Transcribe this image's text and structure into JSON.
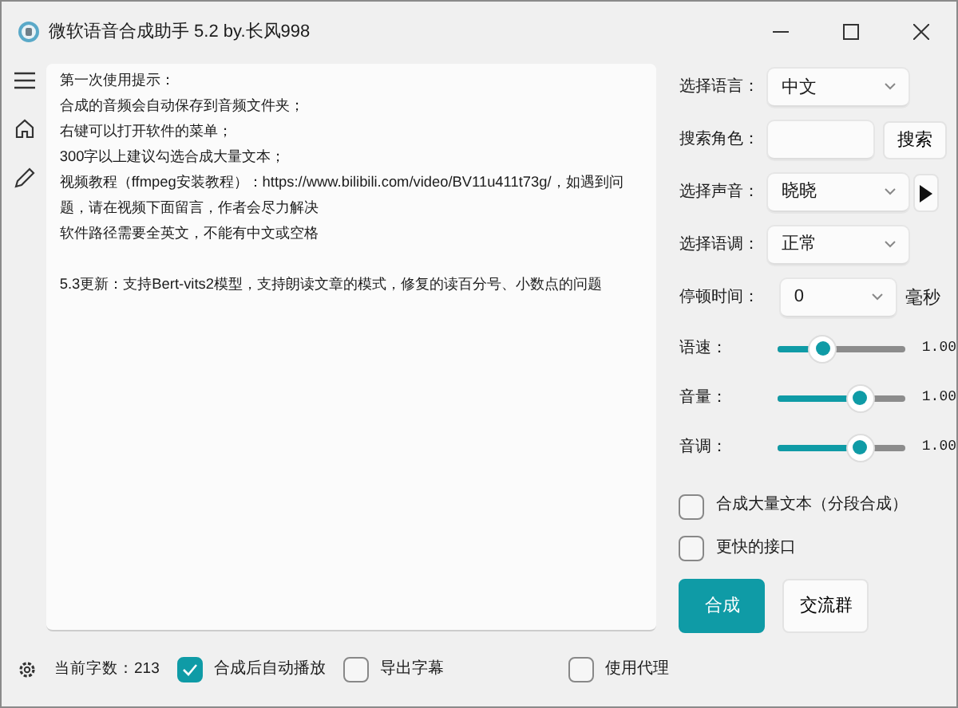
{
  "window": {
    "title": "微软语音合成助手 5.2 by.长风998"
  },
  "editor": {
    "paragraphs": [
      [
        "第一次使用提示：",
        "合成的音频会自动保存到音频文件夹；",
        "右键可以打开软件的菜单；",
        "300字以上建议勾选合成大量文本；",
        "视频教程（ffmpeg安装教程）：https://www.bilibili.com/video/BV11u411t73g/，如遇到问",
        "题，请在视频下面留言，作者会尽力解决",
        "软件路径需要全英文，不能有中文或空格"
      ],
      [
        "5.3更新：支持Bert-vits2模型，支持朗读文章的模式，修复的读百分号、小数点的问题"
      ]
    ]
  },
  "settings": [
    {
      "kind": "dropdown",
      "label": "选择语言：",
      "value": "中文"
    },
    {
      "kind": "search",
      "label": "搜索角色：",
      "button": "搜索"
    },
    {
      "kind": "dropdown",
      "label": "选择声音：",
      "value": "晓晓",
      "play": true
    },
    {
      "kind": "dropdown",
      "label": "选择语调：",
      "value": "正常"
    },
    {
      "kind": "pause",
      "label": "停顿时间：",
      "value": "0",
      "unit": "毫秒"
    },
    {
      "kind": "slider",
      "label": "语速：",
      "level": 0.35,
      "reading": "1.00"
    },
    {
      "kind": "slider",
      "label": "音量：",
      "level": 0.64,
      "reading": "1.00"
    },
    {
      "kind": "slider",
      "label": "音调：",
      "level": 0.64,
      "reading": "1.00"
    }
  ],
  "options": [
    {
      "label": "合成大量文本（分段合成）",
      "checked": false
    },
    {
      "label": "更快的接口",
      "checked": false
    }
  ],
  "buttons": [
    {
      "label": "合成",
      "primary": true
    },
    {
      "label": "交流群",
      "primary": false
    }
  ],
  "status_bar": {
    "count": "当前字数：213",
    "checks": [
      {
        "label": "合成后自动播放",
        "checked": true
      },
      {
        "label": "导出字幕",
        "checked": false
      }
    ],
    "proxy": {
      "label": "使用代理",
      "checked": false
    }
  }
}
